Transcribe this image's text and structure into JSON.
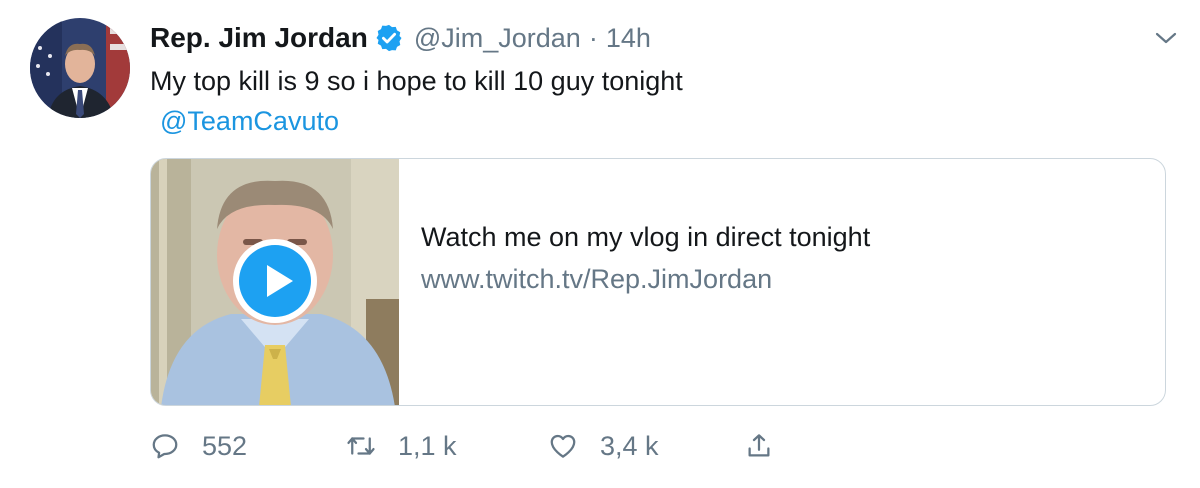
{
  "tweet": {
    "name": "Rep. Jim Jordan",
    "handle": "@Jim_Jordan",
    "separator": "·",
    "time": "14h",
    "text": "My top kill is 9 so i hope to kill 10 guy tonight",
    "mention": "@TeamCavuto"
  },
  "card": {
    "title": "Watch me on my vlog in direct tonight",
    "url": "www.twitch.tv/Rep.JimJordan"
  },
  "actions": {
    "reply_count": "552",
    "retweet_count": "1,1 k",
    "like_count": "3,4 k"
  },
  "colors": {
    "link": "#1b95e0",
    "secondary": "#657786",
    "verified": "#1da1f2",
    "border": "#ccd6dd"
  }
}
